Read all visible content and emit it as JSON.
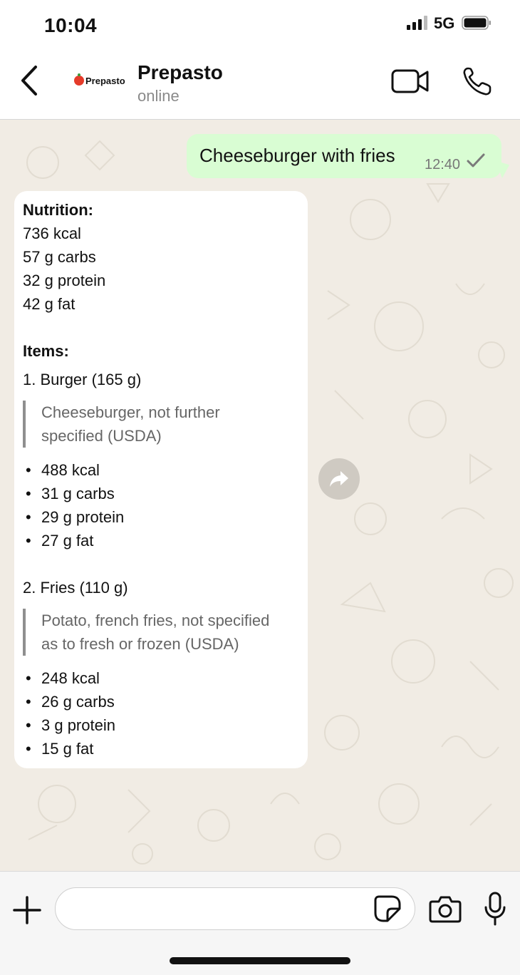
{
  "status_bar": {
    "time": "10:04",
    "network": "5G"
  },
  "header": {
    "avatar_text": "Prepasto",
    "name": "Prepasto",
    "status": "online"
  },
  "outgoing": {
    "text": "Cheeseburger with fries",
    "time": "12:40"
  },
  "incoming": {
    "nutrition_label": "Nutrition:",
    "nutrition": [
      "736 kcal",
      "57 g carbs",
      "32 g protein",
      "42 g fat"
    ],
    "items_label": "Items:",
    "items": [
      {
        "title": "1. Burger (165 g)",
        "quote_line1": "Cheeseburger, not further",
        "quote_line2": "specified (USDA)",
        "facts": [
          "488 kcal",
          "31 g carbs",
          "29 g protein",
          "27 g fat"
        ]
      },
      {
        "title": "2. Fries (110 g)",
        "quote_line1": "Potato, french fries, not specified",
        "quote_line2": "as to fresh or frozen (USDA)",
        "facts": [
          "248 kcal",
          "26 g carbs",
          "3 g protein",
          "15 g fat"
        ]
      }
    ]
  },
  "icons": {
    "back": "chevron-left-icon",
    "video": "video-camera-icon",
    "call": "phone-icon",
    "forward": "forward-arrow-icon",
    "plus": "plus-icon",
    "sticker": "sticker-icon",
    "camera": "camera-icon",
    "mic": "microphone-icon"
  },
  "colors": {
    "outgoing_bubble": "#d9fdd3",
    "incoming_bubble": "#ffffff",
    "chat_background": "#f1ece4"
  }
}
